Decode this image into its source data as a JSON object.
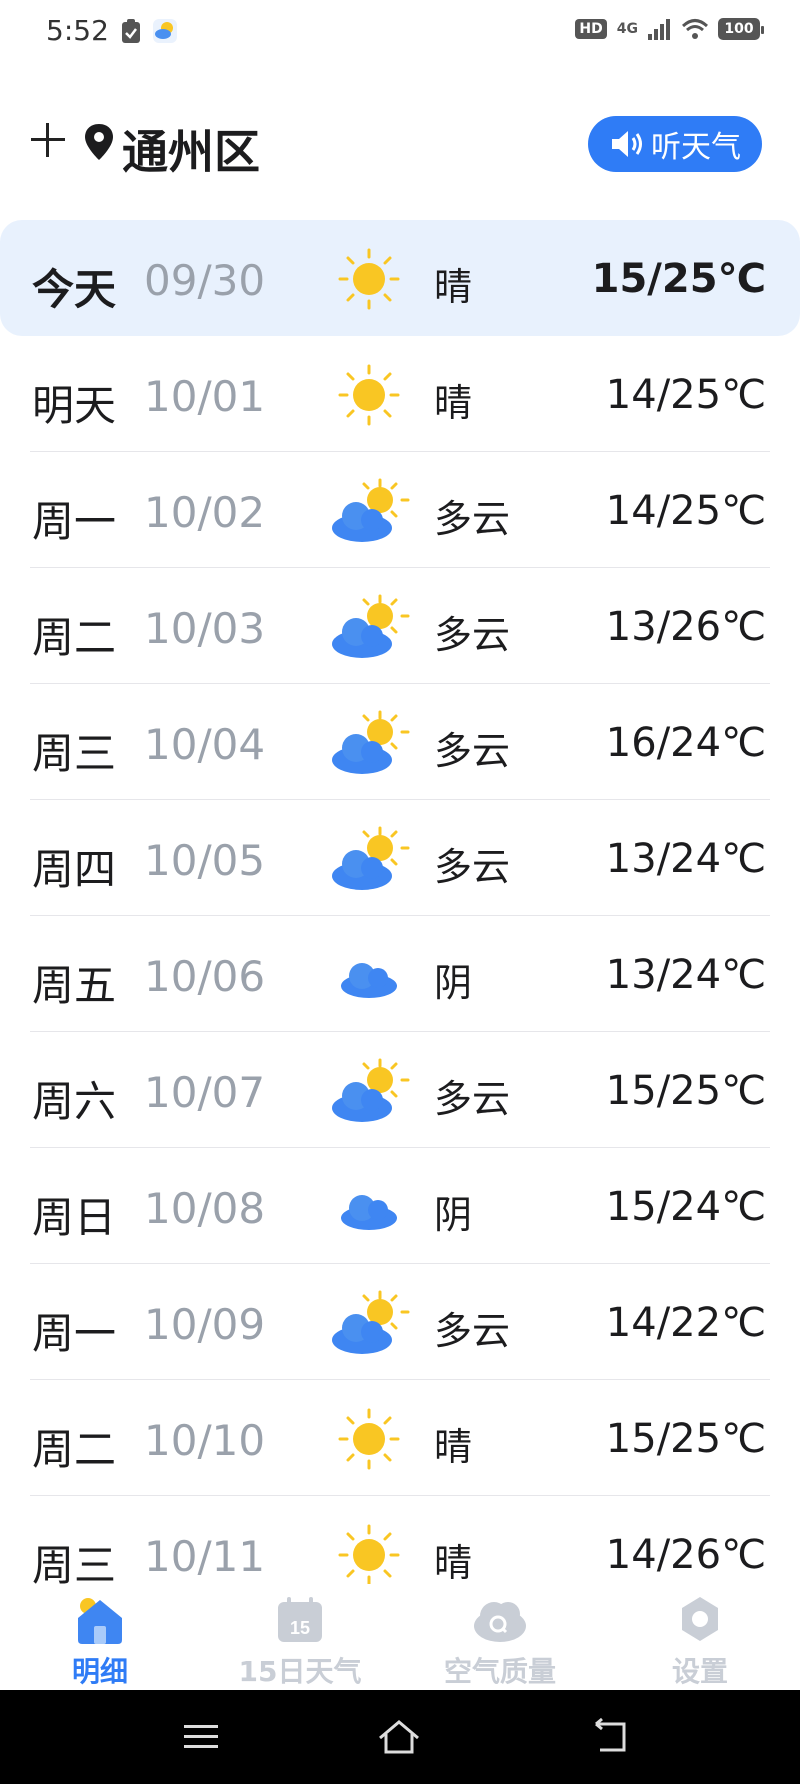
{
  "status_bar": {
    "time": "5:52",
    "hd": "HD",
    "network": "4G",
    "battery": "100"
  },
  "header": {
    "city": "通州区",
    "listen_label": "听天气"
  },
  "colors": {
    "accent": "#2f7cf6",
    "today_bg": "#e8f1fd",
    "date_gray": "#9aa1ab",
    "inactive_nav": "#c9ced6"
  },
  "forecast": [
    {
      "day": "今天",
      "date": "09/30",
      "icon": "sun-icon",
      "condition": "晴",
      "temp": "15/25℃"
    },
    {
      "day": "明天",
      "date": "10/01",
      "icon": "sun-icon",
      "condition": "晴",
      "temp": "14/25℃"
    },
    {
      "day": "周一",
      "date": "10/02",
      "icon": "partly-cloudy-icon",
      "condition": "多云",
      "temp": "14/25℃"
    },
    {
      "day": "周二",
      "date": "10/03",
      "icon": "partly-cloudy-icon",
      "condition": "多云",
      "temp": "13/26℃"
    },
    {
      "day": "周三",
      "date": "10/04",
      "icon": "partly-cloudy-icon",
      "condition": "多云",
      "temp": "16/24℃"
    },
    {
      "day": "周四",
      "date": "10/05",
      "icon": "partly-cloudy-icon",
      "condition": "多云",
      "temp": "13/24℃"
    },
    {
      "day": "周五",
      "date": "10/06",
      "icon": "cloud-icon",
      "condition": "阴",
      "temp": "13/24℃"
    },
    {
      "day": "周六",
      "date": "10/07",
      "icon": "partly-cloudy-icon",
      "condition": "多云",
      "temp": "15/25℃"
    },
    {
      "day": "周日",
      "date": "10/08",
      "icon": "cloud-icon",
      "condition": "阴",
      "temp": "15/24℃"
    },
    {
      "day": "周一",
      "date": "10/09",
      "icon": "partly-cloudy-icon",
      "condition": "多云",
      "temp": "14/22℃"
    },
    {
      "day": "周二",
      "date": "10/10",
      "icon": "sun-icon",
      "condition": "晴",
      "temp": "15/25℃"
    },
    {
      "day": "周三",
      "date": "10/11",
      "icon": "sun-icon",
      "condition": "晴",
      "temp": "14/26℃"
    }
  ],
  "bottom_nav": [
    {
      "label": "明细",
      "icon": "home-icon",
      "active": true
    },
    {
      "label": "15日天气",
      "icon": "calendar-icon",
      "calendar_num": "15",
      "active": false
    },
    {
      "label": "空气质量",
      "icon": "air-quality-icon",
      "active": false
    },
    {
      "label": "设置",
      "icon": "settings-icon",
      "active": false
    }
  ]
}
